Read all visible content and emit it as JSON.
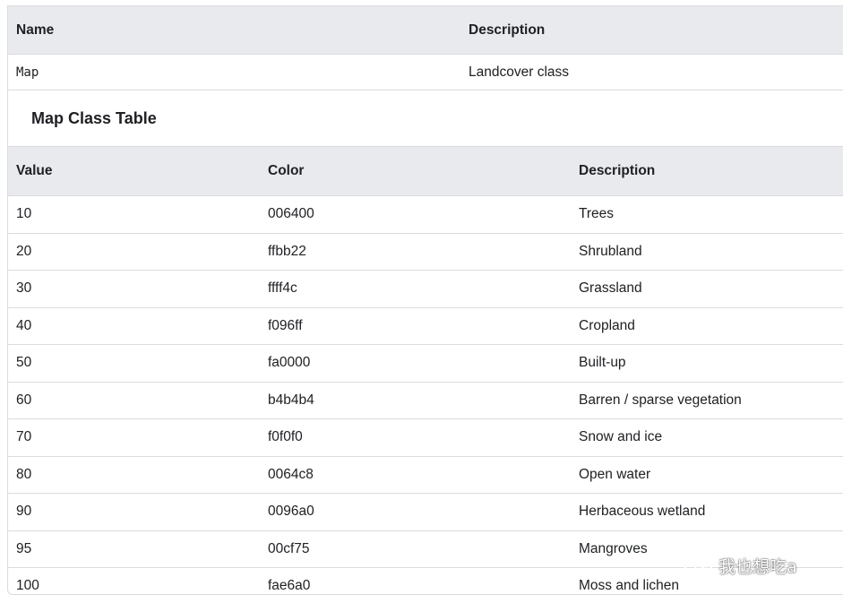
{
  "bands_table": {
    "headers": [
      "Name",
      "Description"
    ],
    "rows": [
      [
        "Map",
        "Landcover class"
      ]
    ]
  },
  "class_table": {
    "title": "Map Class Table",
    "headers": [
      "Value",
      "Color",
      "Description"
    ],
    "rows": [
      [
        "10",
        "006400",
        "Trees"
      ],
      [
        "20",
        "ffbb22",
        "Shrubland"
      ],
      [
        "30",
        "ffff4c",
        "Grassland"
      ],
      [
        "40",
        "f096ff",
        "Cropland"
      ],
      [
        "50",
        "fa0000",
        "Built-up"
      ],
      [
        "60",
        "b4b4b4",
        "Barren / sparse vegetation"
      ],
      [
        "70",
        "f0f0f0",
        "Snow and ice"
      ],
      [
        "80",
        "0064c8",
        "Open water"
      ],
      [
        "90",
        "0096a0",
        "Herbaceous wetland"
      ],
      [
        "95",
        "00cf75",
        "Mangroves"
      ],
      [
        "100",
        "fae6a0",
        "Moss and lichen"
      ]
    ]
  },
  "watermark": {
    "text": "我也想吃a",
    "icon": "wechat-icon"
  }
}
